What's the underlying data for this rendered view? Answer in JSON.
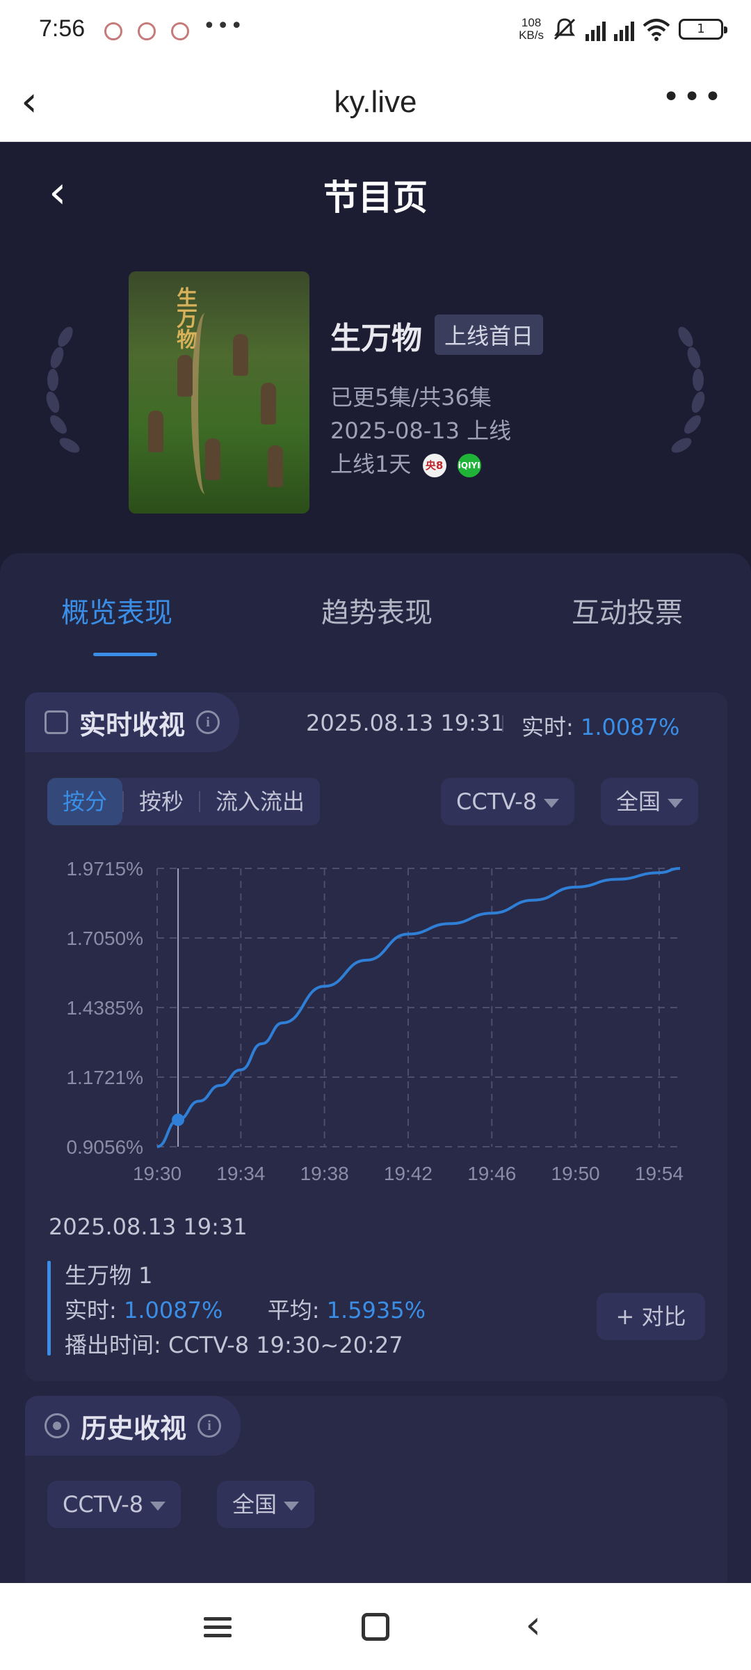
{
  "status_bar": {
    "time": "7:56",
    "dots": "•••",
    "speed": "108\nKB/s",
    "battery": "1"
  },
  "browser": {
    "back_glyph": "‹",
    "url_title": "ky.live",
    "more_glyph": "•••"
  },
  "page": {
    "back_glyph": "‹",
    "title": "节目页"
  },
  "show": {
    "name": "生万物",
    "badge": "上线首日",
    "episodes": "已更5集/共36集",
    "date": "2025-08-13 上线",
    "days": "上线1天",
    "channel_logo": "央8",
    "platform_logo": "iQIYI",
    "poster_title": "生万物"
  },
  "tabs": [
    {
      "label": "概览表现",
      "active": true
    },
    {
      "label": "趋势表现",
      "active": false
    },
    {
      "label": "互动投票",
      "active": false
    }
  ],
  "realtime": {
    "title": "实时收视",
    "timestamp": "2025.08.13 19:31",
    "label": "实时:",
    "value": "1.0087%",
    "segments": [
      "按分",
      "按秒",
      "流入流出"
    ],
    "channel": "CCTV-8",
    "region": "全国"
  },
  "chart_data": {
    "type": "line",
    "x": [
      "19:30",
      "19:31",
      "19:32",
      "19:33",
      "19:34",
      "19:35",
      "19:36",
      "19:38",
      "19:40",
      "19:42",
      "19:44",
      "19:46",
      "19:48",
      "19:50",
      "19:52",
      "19:54",
      "19:55"
    ],
    "series": [
      {
        "values": [
          0.9056,
          1.0087,
          1.08,
          1.14,
          1.2,
          1.3,
          1.38,
          1.52,
          1.62,
          1.72,
          1.76,
          1.8,
          1.85,
          1.9,
          1.93,
          1.955,
          1.9715
        ]
      }
    ],
    "yticks": [
      "1.9715%",
      "1.7050%",
      "1.4385%",
      "1.1721%",
      "0.9056%"
    ],
    "xticks": [
      "19:30",
      "19:34",
      "19:38",
      "19:42",
      "19:46",
      "19:50",
      "19:54"
    ],
    "ylim": [
      0.9056,
      1.9715
    ],
    "grid": true,
    "line_color": "#2f7fd6",
    "highlight_x": "19:31",
    "highlight_y": 1.0087
  },
  "tooltip": {
    "time": "2025.08.13 19:31",
    "name": "生万物 1",
    "rt_label": "实时:",
    "rt_value": "1.0087%",
    "avg_label": "平均:",
    "avg_value": "1.5935%",
    "air_label": "播出时间:",
    "air_value": "CCTV-8 19:30~20:27",
    "compare": "+ 对比"
  },
  "history": {
    "title": "历史收视",
    "channel": "CCTV-8",
    "region": "全国"
  },
  "colors": {
    "accent": "#3a8ee6",
    "background": "#1c1d32",
    "panel": "#232541"
  }
}
